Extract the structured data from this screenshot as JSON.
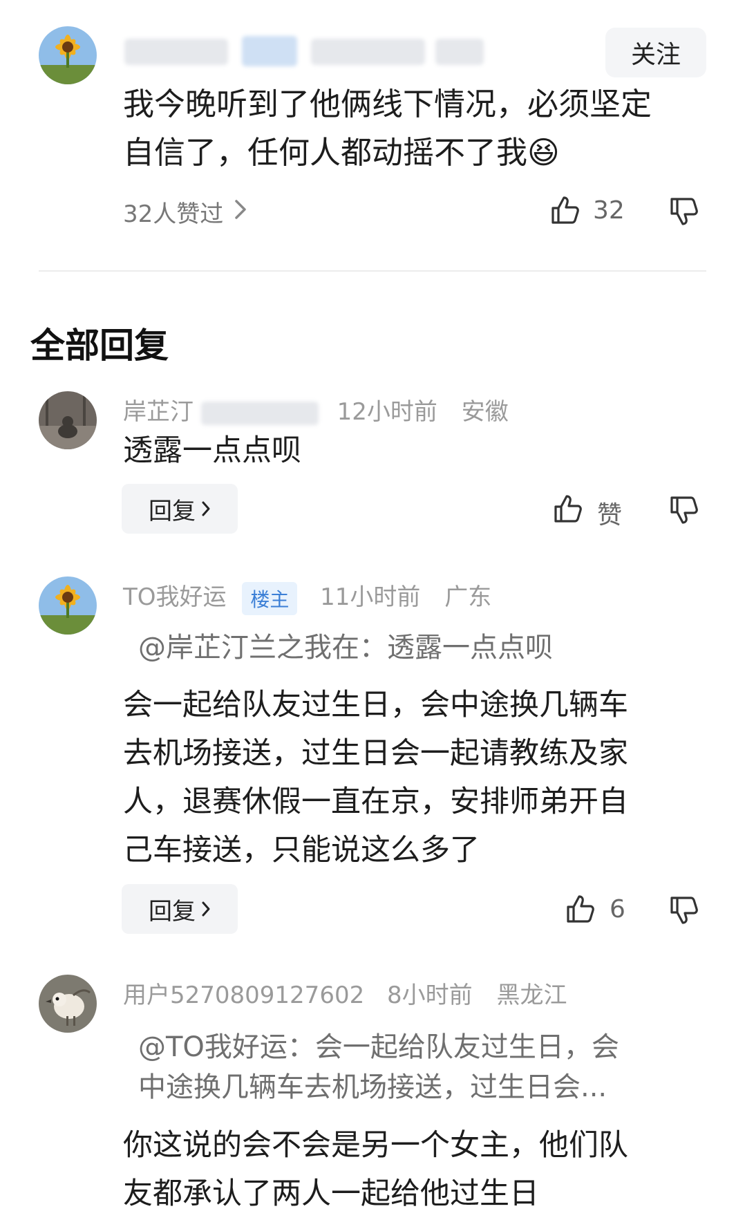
{
  "main_comment": {
    "follow_label": "关注",
    "text_line1": "我今晚听到了他俩线下情况，必须坚定",
    "text_line2": "自信了，任何人都动摇不了我",
    "emoji": "😆",
    "likers_text": "32人赞过",
    "like_count": "32"
  },
  "section_title": "全部回复",
  "replies": [
    {
      "name": "岸芷汀",
      "time": "12小时前",
      "location": "安徽",
      "text": "透露一点点呗",
      "reply_label": "回复",
      "like_label": "赞"
    },
    {
      "name": "TO我好运",
      "badge": "楼主",
      "time": "11小时前",
      "location": "广东",
      "quote": "@岸芷汀兰之我在：透露一点点呗",
      "text_line1": "会一起给队友过生日，会中途换几辆车",
      "text_line2": "去机场接送，过生日会一起请教练及家",
      "text_line3": "人，退赛休假一直在京，安排师弟开自",
      "text_line4": "己车接送，只能说这么多了",
      "reply_label": "回复",
      "like_count": "6"
    },
    {
      "name": "用户5270809127602",
      "time": "8小时前",
      "location": "黑龙江",
      "quote_line1": "@TO我好运：会一起给队友过生日，会",
      "quote_line2": "中途换几辆车去机场接送，过生日会...",
      "text_line1": "你这说的会不会是另一个女主，他们队",
      "text_line2": "友都承认了两人一起给他过生日"
    }
  ],
  "icons": [
    "sunflower-avatar",
    "cat-avatar",
    "bird-avatar",
    "thumbs-up-icon",
    "thumbs-down-icon",
    "chevron-right-icon"
  ]
}
